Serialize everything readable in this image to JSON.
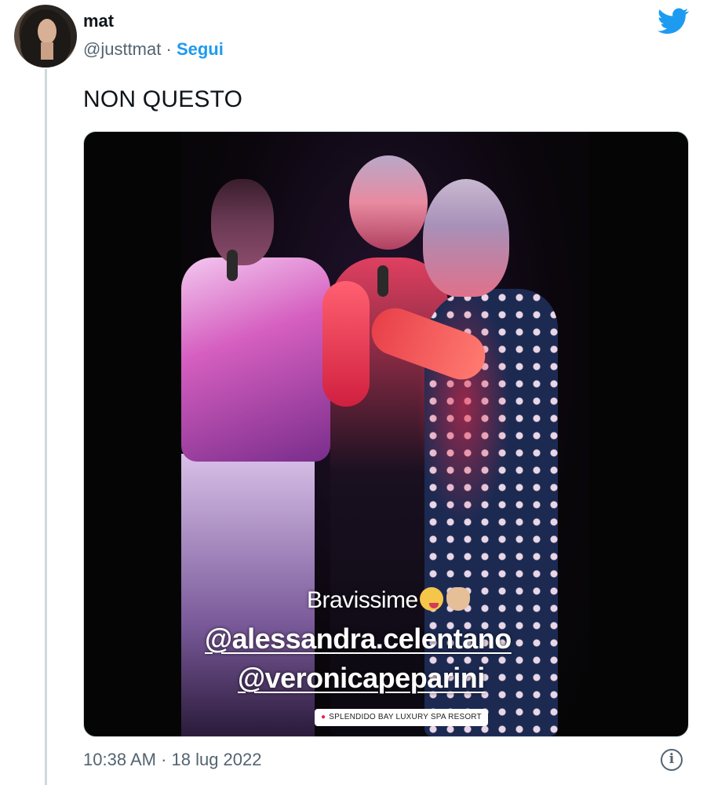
{
  "author": {
    "name": "mat",
    "handle": "@justtmat",
    "separator": "·",
    "follow_label": "Segui"
  },
  "tweet": {
    "text": "NON QUESTO",
    "timestamp": "10:38 AM · 18 lug 2022"
  },
  "media": {
    "caption": "Bravissime",
    "emojis": [
      "winking-face-tongue",
      "clapping-hands"
    ],
    "mentions": [
      "@alessandra.celentano",
      "@veronicapeparini"
    ],
    "location": "SPLENDIDO BAY LUXURY SPA RESORT"
  },
  "icons": {
    "brand": "twitter-bird-icon",
    "info": "info-icon"
  },
  "colors": {
    "accent": "#1d9bf0",
    "text_primary": "#0f1419",
    "text_secondary": "#536471",
    "border": "#cfd9de"
  }
}
